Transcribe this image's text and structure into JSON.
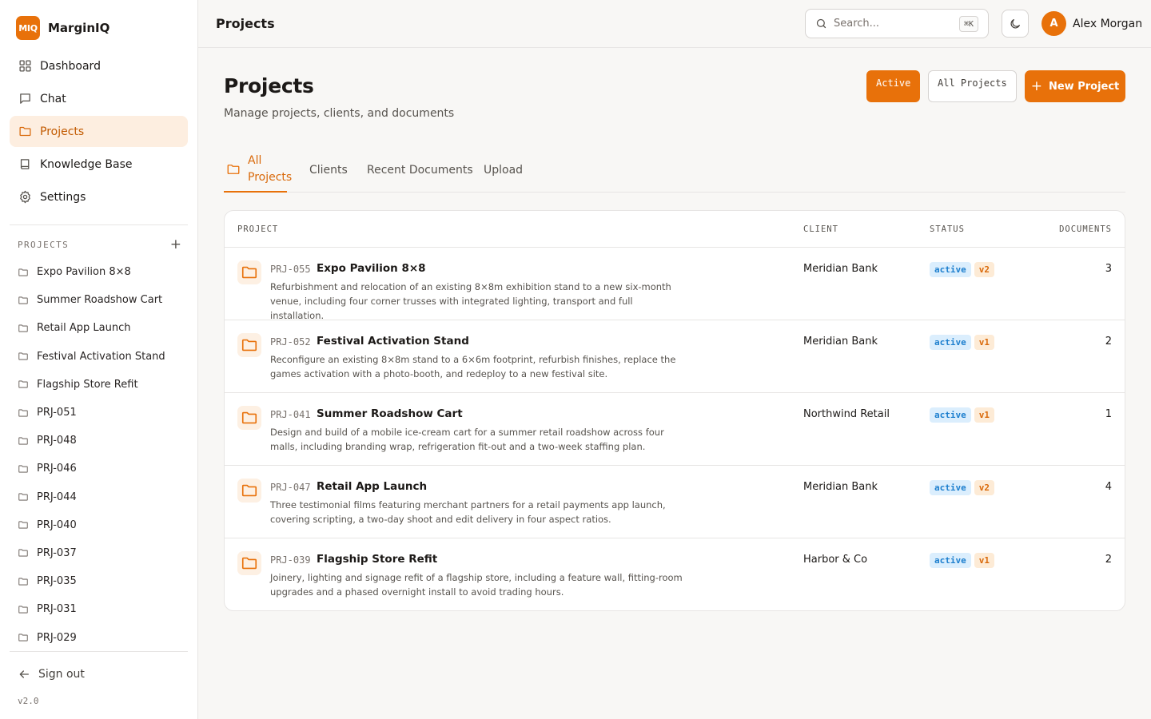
{
  "app": {
    "logo": "MIQ",
    "name": "MarginIQ",
    "version": "v2.0"
  },
  "nav": [
    {
      "label": "Dashboard",
      "icon": "dashboard-icon"
    },
    {
      "label": "Chat",
      "icon": "chat-icon"
    },
    {
      "label": "Projects",
      "icon": "folder-icon",
      "active": true
    },
    {
      "label": "Knowledge Base",
      "icon": "book-icon"
    },
    {
      "label": "Settings",
      "icon": "gear-icon"
    }
  ],
  "sidebar_projects": {
    "header": "PROJECTS",
    "items": [
      "Expo Pavilion 8×8",
      "Summer Roadshow Cart",
      "Retail App Launch",
      "Festival Activation Stand",
      "Flagship Store Refit",
      "PRJ-051",
      "PRJ-048",
      "PRJ-046",
      "PRJ-044",
      "PRJ-040",
      "PRJ-037",
      "PRJ-035",
      "PRJ-031",
      "PRJ-029"
    ]
  },
  "signout": "Sign out",
  "topbar": {
    "title": "Projects",
    "search_placeholder": "Search...",
    "shortcut": "⌘K",
    "user_initial": "A",
    "user_name": "Alex Morgan"
  },
  "page": {
    "title": "Projects",
    "subtitle": "Manage projects, clients, and documents",
    "filter_active": "Active",
    "filter_all": "All Projects",
    "new_button": "New Project"
  },
  "tabs": [
    {
      "label_line1": "All",
      "label_line2": "Projects",
      "active": true
    },
    {
      "label": "Clients"
    },
    {
      "label": "Recent Documents"
    },
    {
      "label": "Upload"
    }
  ],
  "table": {
    "headers": {
      "project": "PROJECT",
      "client": "CLIENT",
      "status": "STATUS",
      "documents": "DOCUMENTS"
    },
    "rows": [
      {
        "code": "PRJ-055",
        "name": "Expo Pavilion 8×8",
        "desc": "Refurbishment and relocation of an existing 8×8m exhibition stand to a new six-month venue, including four corner trusses with integrated lighting, transport and full installation.",
        "client": "Meridian Bank",
        "status": "active",
        "version": "v2",
        "documents": "3"
      },
      {
        "code": "PRJ-052",
        "name": "Festival Activation Stand",
        "desc": "Reconfigure an existing 8×8m stand to a 6×6m footprint, refurbish finishes, replace the games activation with a photo-booth, and redeploy to a new festival site.",
        "client": "Meridian Bank",
        "status": "active",
        "version": "v1",
        "documents": "2"
      },
      {
        "code": "PRJ-041",
        "name": "Summer Roadshow Cart",
        "desc": "Design and build of a mobile ice-cream cart for a summer retail roadshow across four malls, including branding wrap, refrigeration fit-out and a two-week staffing plan.",
        "client": "Northwind Retail",
        "status": "active",
        "version": "v1",
        "documents": "1"
      },
      {
        "code": "PRJ-047",
        "name": "Retail App Launch",
        "desc": "Three testimonial films featuring merchant partners for a retail payments app launch, covering scripting, a two-day shoot and edit delivery in four aspect ratios.",
        "client": "Meridian Bank",
        "status": "active",
        "version": "v2",
        "documents": "4"
      },
      {
        "code": "PRJ-039",
        "name": "Flagship Store Refit",
        "desc": "Joinery, lighting and signage refit of a flagship store, including a feature wall, fitting-room upgrades and a phased overnight install to avoid trading hours.",
        "client": "Harbor & Co",
        "status": "active",
        "version": "v1",
        "documents": "2"
      }
    ]
  },
  "colors": {
    "accent": "#e8710a",
    "accent_soft": "#fdeee0",
    "status_bg": "#dbeefd",
    "status_fg": "#1d7fce"
  }
}
